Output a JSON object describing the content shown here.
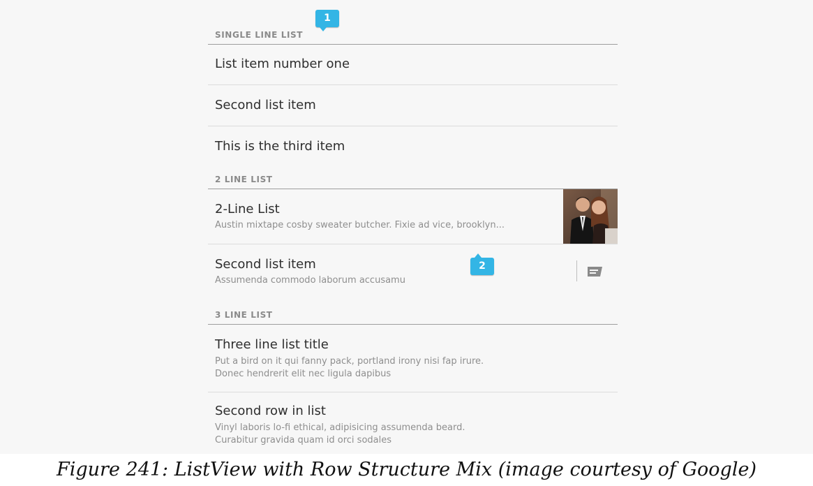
{
  "sections": {
    "single_line": {
      "header": "SINGLE LINE LIST",
      "items": [
        "List item number one",
        "Second list item",
        "This is the third item"
      ]
    },
    "two_line": {
      "header": "2 LINE LIST",
      "items": [
        {
          "title": "2-Line List",
          "subtitle": "Austin mixtape cosby sweater butcher. Fixie ad vice, brooklyn..."
        },
        {
          "title": "Second list item",
          "subtitle": "Assumenda commodo laborum accusamu"
        }
      ]
    },
    "three_line": {
      "header": "3 LINE LIST",
      "items": [
        {
          "title": "Three line list title",
          "line1": "Put a bird on it qui fanny pack, portland irony nisi fap irure.",
          "line2": "Donec hendrerit elit nec ligula dapibus"
        },
        {
          "title": "Second row in list",
          "line1": "Vinyl laboris lo-fi ethical, adipisicing assumenda beard.",
          "line2": "Curabitur gravida quam id orci sodales"
        }
      ]
    }
  },
  "badges": [
    "1",
    "2"
  ],
  "icons": {
    "thumbnail": "couple-photo-thumbnail",
    "secondary_action": "message-icon"
  },
  "colors": {
    "accent": "#33b5e5",
    "background": "#f7f7f7",
    "header_text": "#8a8a8a",
    "primary_text": "#2e2e2e",
    "secondary_text": "#8e8e8e"
  },
  "caption": "Figure 241: ListView with Row Structure Mix (image courtesy of Google)"
}
